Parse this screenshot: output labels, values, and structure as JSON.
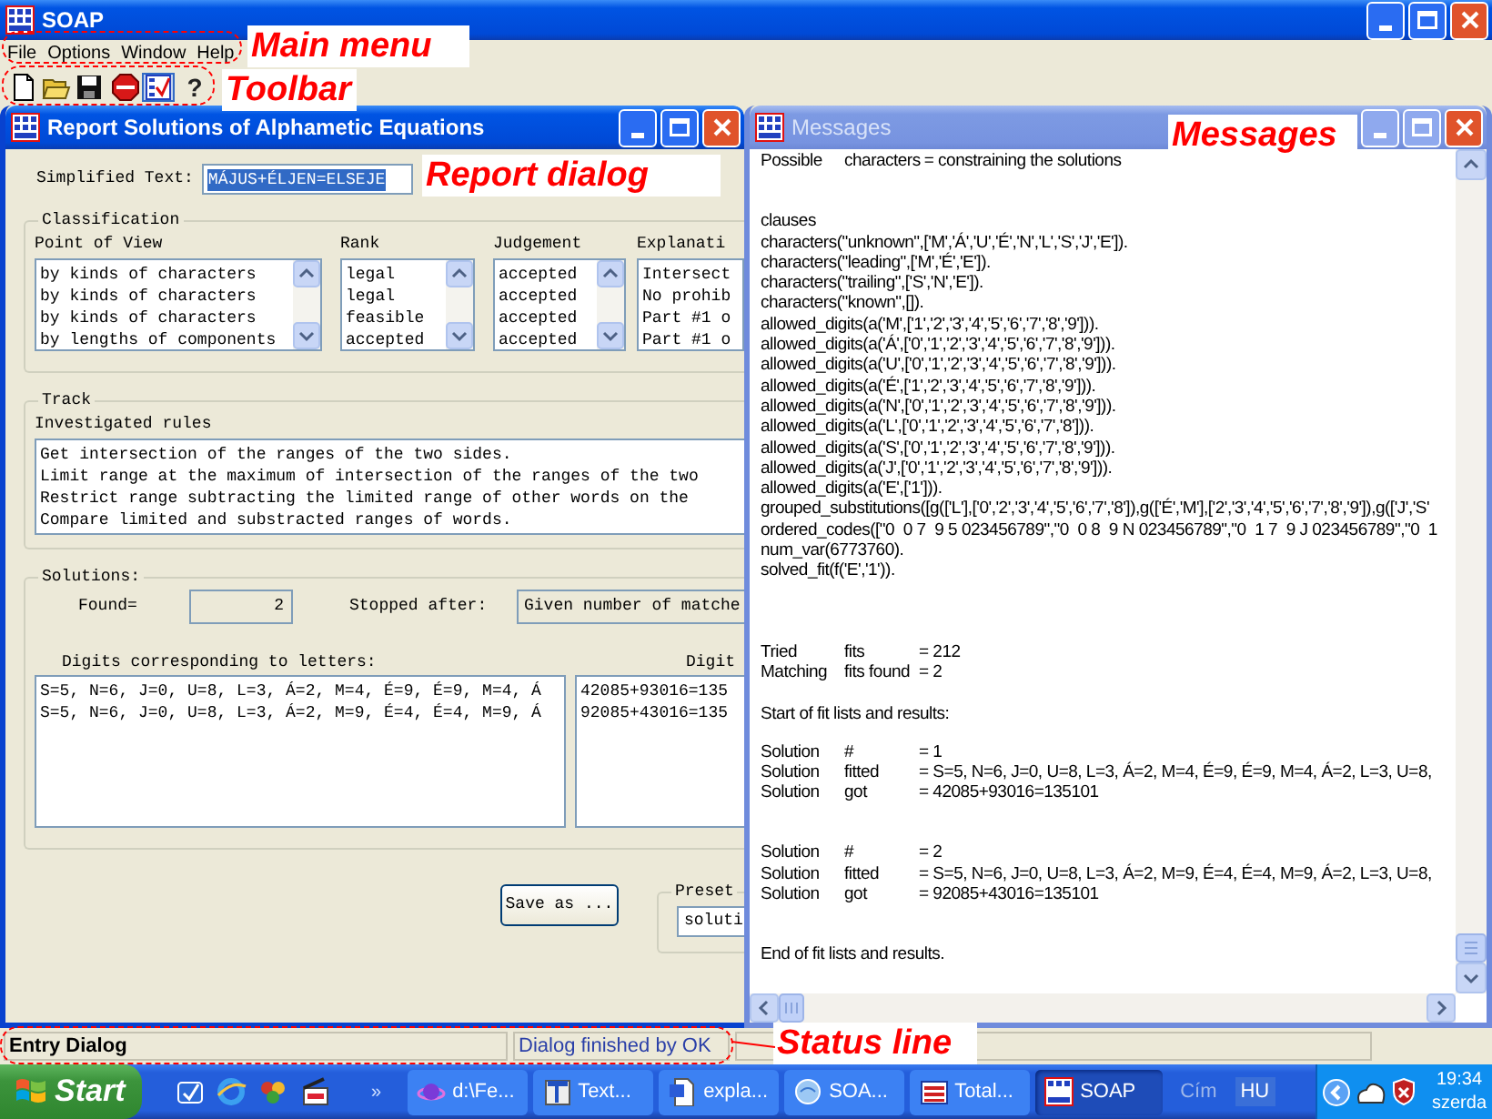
{
  "app": {
    "title": "SOAP"
  },
  "menu": [
    {
      "label": "File"
    },
    {
      "label": "Options"
    },
    {
      "label": "Window"
    },
    {
      "label": "Help"
    }
  ],
  "toolbar": [
    {
      "kind": "new",
      "selected": false
    },
    {
      "kind": "open",
      "selected": false
    },
    {
      "kind": "save",
      "selected": false
    },
    {
      "kind": "stop",
      "selected": false
    },
    {
      "kind": "solve",
      "selected": true
    },
    {
      "kind": "help",
      "label": "?",
      "selected": false
    }
  ],
  "report_dialog": {
    "title": "Report Solutions of Alphametic Equations",
    "active": true,
    "simplified_text": {
      "label": "Simplified Text:",
      "value": "MÁJUS+ÉLJEN=ELSEJE"
    },
    "classification": {
      "title": "Classification",
      "columns": [
        {
          "header": "Point of View",
          "rows": [
            "by kinds of characters",
            "by kinds of characters",
            "by kinds of characters",
            "by lengths of components"
          ]
        },
        {
          "header": "Rank",
          "rows": [
            "legal",
            "legal",
            "feasible",
            "accepted"
          ]
        },
        {
          "header": "Judgement",
          "rows": [
            "accepted",
            "accepted",
            "accepted",
            "accepted"
          ]
        },
        {
          "header": "Explanati",
          "rows": [
            "Intersect",
            "No prohib",
            "Part #1 o",
            "Part #1 o"
          ]
        }
      ]
    },
    "track": {
      "title": "Track",
      "label": "Investigated rules",
      "rules": [
        "Get intersection of the ranges of the two sides.",
        "Limit range at the maximum of intersection of the ranges of the two",
        "Restrict range subtracting the limited range of other words on the",
        "Compare limited and substracted ranges of words."
      ]
    },
    "solutions": {
      "title": "Solutions:",
      "found_label": "Found=",
      "found": "2",
      "stopped_label": "Stopped after:",
      "stopped_value": "Given number of matche",
      "digits_label": "Digits corresponding to letters:",
      "digits": [
        "S=5, N=6, J=0, U=8, L=3, Á=2, M=4, É=9, É=9, M=4, Á",
        "S=5, N=6, J=0, U=8, L=3, Á=2, M=9, É=4, É=4, M=9, Á"
      ],
      "column_2_label": "Digit",
      "column_2": [
        "42085+93016=135",
        "92085+43016=135"
      ]
    },
    "save_button": "Save as ...",
    "preset": {
      "title": "Preset",
      "value": "soluti"
    }
  },
  "messages": {
    "title": "Messages",
    "active": false,
    "blocks": [
      [
        [
          "Possible",
          "characters",
          "= constraining the solutions"
        ]
      ],
      [
        "clauses",
        "characters(\"unknown\",['M','Á','U','É','N','L','S','J','E']).",
        "characters(\"leading\",['M','É','E']).",
        "characters(\"trailing\",['S','N','E']).",
        "characters(\"known\",[]).",
        "allowed_digits(a('M',['1','2','3','4','5','6','7','8','9'])).",
        "allowed_digits(a('Á',['0','1','2','3','4','5','6','7','8','9'])).",
        "allowed_digits(a('U',['0','1','2','3','4','5','6','7','8','9'])).",
        "allowed_digits(a('É',['1','2','3','4','5','6','7','8','9'])).",
        "allowed_digits(a('N',['0','1','2','3','4','5','6','7','8','9'])).",
        "allowed_digits(a('L',['0','1','2','3','4','5','6','7','8'])).",
        "allowed_digits(a('S',['0','1','2','3','4','5','6','7','8','9'])).",
        "allowed_digits(a('J',['0','1','2','3','4','5','6','7','8','9'])).",
        "allowed_digits(a('E',['1'])).",
        "grouped_substitutions([g(['L'],['0','2','3','4','5','6','7','8']),g(['É','M'],['2','3','4','5','6','7','8','9']),g(['J','S'",
        "ordered_codes([\"0  0 7  9 5 023456789\",\"0  0 8  9 N 023456789\",\"0  1 7  9 J 023456789\",\"0  1",
        "num_var(6773760).",
        "solved_fit(f('E','1'))."
      ],
      [
        [
          "Tried",
          "fits",
          "= 212"
        ],
        [
          "Matching",
          "fits found",
          "= 2"
        ]
      ],
      [
        "Start of fit lists and results:"
      ],
      [
        [
          "Solution",
          "#",
          "= 1"
        ],
        [
          "Solution",
          "fitted",
          "= S=5, N=6, J=0, U=8, L=3, Á=2, M=4, É=9, É=9, M=4, Á=2, L=3, U=8,"
        ],
        [
          "Solution",
          "got",
          "= 42085+93016=135101"
        ]
      ],
      [
        [
          "Solution",
          "#",
          "= 2"
        ],
        [
          "Solution",
          "fitted",
          "= S=5, N=6, J=0, U=8, L=3, Á=2, M=9, É=4, É=4, M=9, Á=2, L=3, U=8,"
        ],
        [
          "Solution",
          "got",
          "= 92085+43016=135101"
        ]
      ],
      [
        "End of fit lists and results."
      ]
    ]
  },
  "status_bar": {
    "left": "Entry Dialog",
    "right": "Dialog finished by OK"
  },
  "taskbar": {
    "start": "Start",
    "overflow": "»",
    "tasks": [
      {
        "kind": "planet",
        "label": "d:\\Fe...",
        "selected": false
      },
      {
        "kind": "text",
        "label": "Text...",
        "selected": false
      },
      {
        "kind": "doc",
        "label": "expla...",
        "selected": false
      },
      {
        "kind": "globe",
        "label": "SOA...",
        "selected": false
      },
      {
        "kind": "total",
        "label": "Total...",
        "selected": false
      },
      {
        "kind": "soap",
        "label": "SOAP",
        "selected": true
      }
    ],
    "address_label": "Cím",
    "language": "HU",
    "clock": "19:34",
    "day": "szerda"
  },
  "annotations": [
    {
      "text": "Main menu"
    },
    {
      "text": "Toolbar"
    },
    {
      "text": "Report dialog"
    },
    {
      "text": "Messages"
    },
    {
      "text": "Status line"
    }
  ]
}
